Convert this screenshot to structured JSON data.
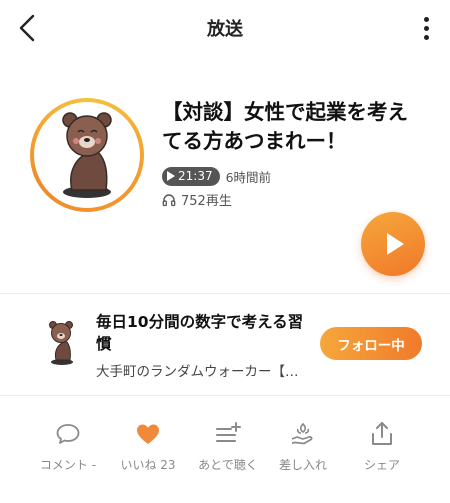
{
  "header": {
    "title": "放送",
    "back_icon": "chevron-left-icon",
    "more_icon": "more-vertical-icon"
  },
  "episode": {
    "title": "【対談】女性で起業を考えてる方あつまれー！",
    "duration": "21:37",
    "posted": "6時間前",
    "plays": "752再生",
    "play_icon": "play-icon",
    "ring_colors": [
      "#f5c23c",
      "#f08a2a"
    ]
  },
  "channel": {
    "name": "毎日10分間の数字で考える習慣",
    "author": "大手町のランダムウォーカー【…",
    "follow_label": "フォロー中"
  },
  "actions": [
    {
      "label": "コメント -",
      "icon": "comment-icon"
    },
    {
      "label": "いいね 23",
      "icon": "heart-icon",
      "color": "#f08a3a"
    },
    {
      "label": "あとで聴く",
      "icon": "listen-later-icon"
    },
    {
      "label": "差し入れ",
      "icon": "gift-hand-icon"
    },
    {
      "label": "シェア",
      "icon": "share-icon"
    }
  ],
  "colors": {
    "accent": "#f08a2a",
    "text": "#222222",
    "muted": "#8a8a8a"
  }
}
